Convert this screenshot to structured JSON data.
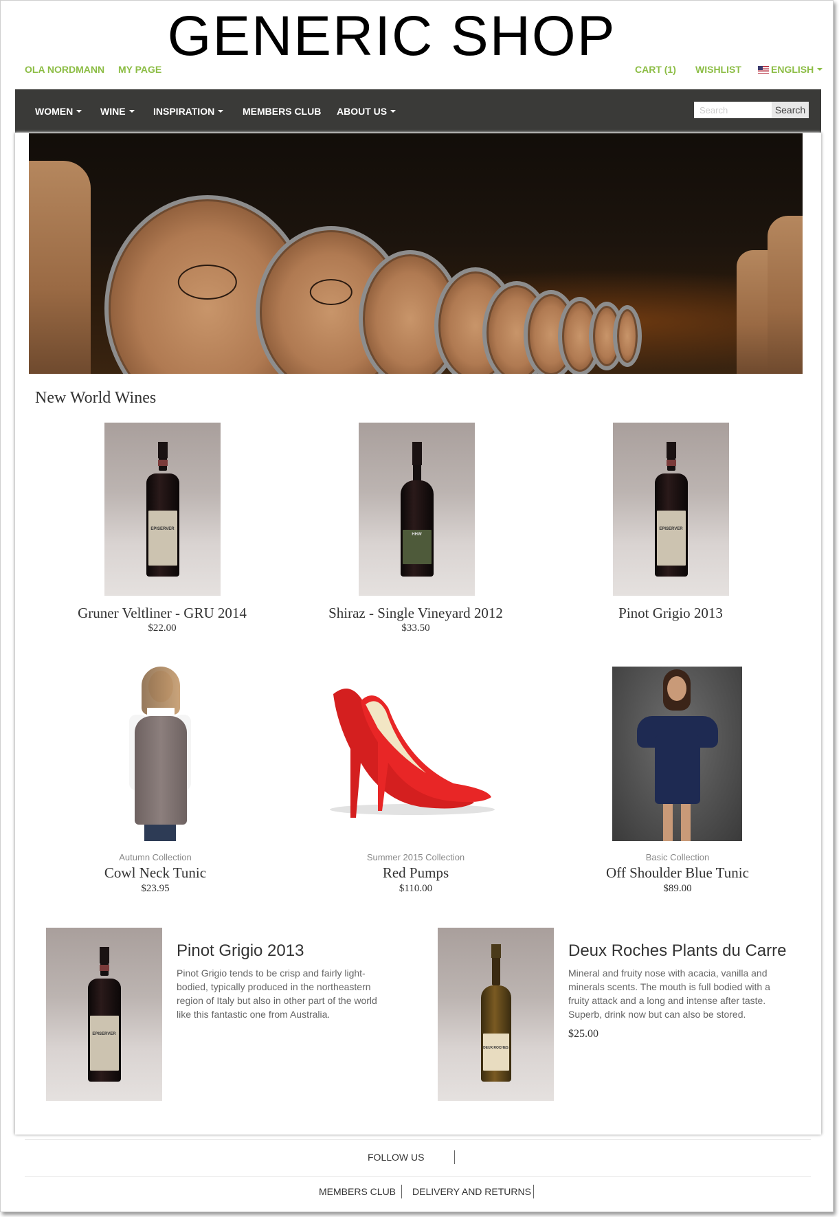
{
  "brand": {
    "title": "GENERIC SHOP"
  },
  "toplinks": {
    "user": "OLA NORDMANN",
    "my_page": "MY PAGE",
    "cart": "CART (1)",
    "wishlist": "WISHLIST",
    "language": "ENGLISH"
  },
  "nav": {
    "items": [
      "WOMEN",
      "WINE",
      "INSPIRATION",
      "MEMBERS CLUB",
      "ABOUT US"
    ],
    "search_placeholder": "Search",
    "search_button": "Search"
  },
  "section": {
    "title": "New World Wines"
  },
  "wines": [
    {
      "name": "Gruner Veltliner - GRU 2014",
      "price": "$22.00",
      "label": "EPISERVER"
    },
    {
      "name": "Shiraz - Single Vineyard 2012",
      "price": "$33.50",
      "label": "HHW"
    },
    {
      "name": "Pinot Grigio 2013",
      "label": "EPISERVER"
    }
  ],
  "fashion": [
    {
      "collection": "Autumn Collection",
      "name": "Cowl Neck Tunic",
      "price": "$23.95"
    },
    {
      "collection": "Summer 2015 Collection",
      "name": "Red Pumps",
      "price": "$110.00"
    },
    {
      "collection": "Basic Collection",
      "name": "Off Shoulder Blue Tunic",
      "price": "$89.00"
    }
  ],
  "promos": [
    {
      "title": "Pinot Grigio 2013",
      "description": "Pinot Grigio tends to be crisp and fairly light-bodied, typically produced in the northeastern region of Italy but also in other part of the world like this fantastic one from Australia.",
      "label": "EPISERVER"
    },
    {
      "title": "Deux Roches Plants du Carre",
      "description": "Mineral and fruity nose with acacia, vanilla and minerals scents. The mouth is full bodied with a fruity attack and a long and intense after taste. Superb, drink now but can also be stored.",
      "price": "$25.00",
      "label": "DEUX ROCHES"
    }
  ],
  "footer": {
    "follow": "FOLLOW US",
    "links": [
      "MEMBERS CLUB",
      "DELIVERY AND RETURNS"
    ]
  },
  "colors": {
    "accent": "#8cbd45",
    "navbar": "#3a3a38"
  }
}
